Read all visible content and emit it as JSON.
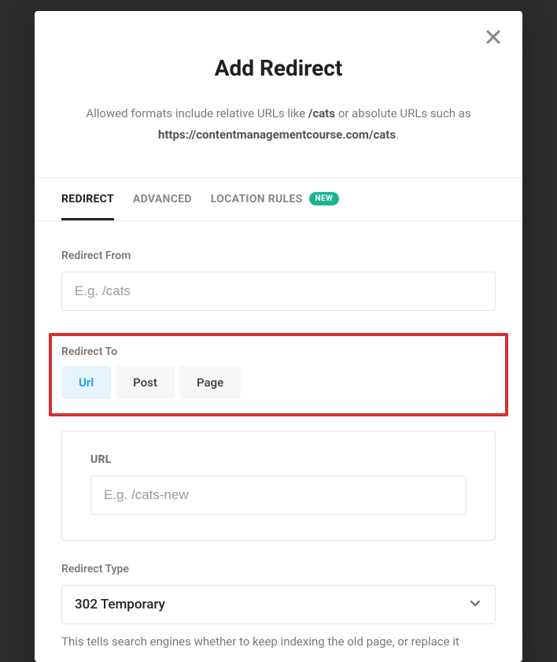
{
  "modal": {
    "title": "Add Redirect",
    "description_prefix": "Allowed formats include relative URLs like ",
    "description_bold1": "/cats",
    "description_mid": " or absolute URLs such as ",
    "description_bold2": "https://contentmanagementcourse.com/cats",
    "description_suffix": "."
  },
  "tabs": {
    "redirect": "REDIRECT",
    "advanced": "ADVANCED",
    "location_rules": "LOCATION RULES",
    "badge_new": "NEW"
  },
  "form": {
    "redirect_from_label": "Redirect From",
    "redirect_from_placeholder": "E.g. /cats",
    "redirect_to_label": "Redirect To",
    "segments": {
      "url": "Url",
      "post": "Post",
      "page": "Page"
    },
    "url_label": "URL",
    "url_placeholder": "E.g. /cats-new",
    "redirect_type_label": "Redirect Type",
    "redirect_type_value": "302 Temporary",
    "redirect_type_help": "This tells search engines whether to keep indexing the old page, or replace it"
  }
}
